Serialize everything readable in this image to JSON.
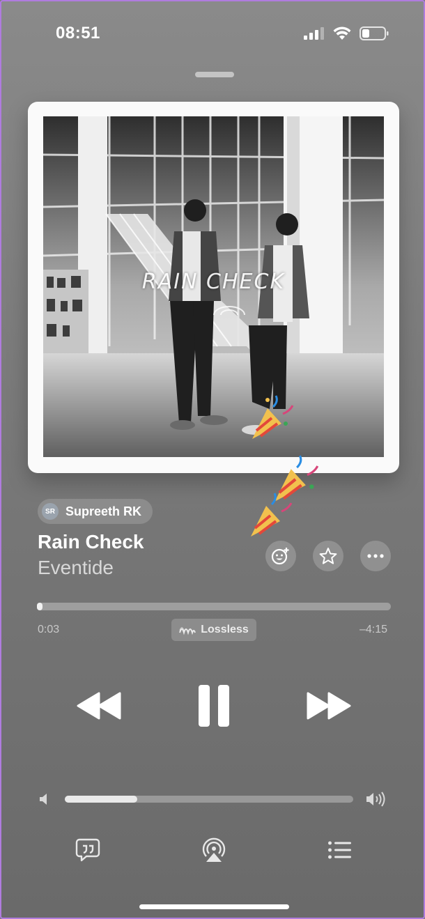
{
  "status_bar": {
    "time": "08:51"
  },
  "artwork": {
    "title_text": "RAIN CHECK"
  },
  "shared_by": {
    "initials": "SR",
    "name": "Supreeth RK"
  },
  "track": {
    "title": "Rain Check",
    "artist": "Eventide"
  },
  "playback": {
    "elapsed": "0:03",
    "remaining": "–4:15",
    "progress_fraction": 0.01,
    "quality_label": "Lossless"
  },
  "volume": {
    "level_fraction": 0.25
  },
  "icons": {
    "signal": "cellular-signal-icon",
    "wifi": "wifi-icon",
    "battery": "battery-icon",
    "react": "add-reaction-icon",
    "favorite": "star-icon",
    "more": "ellipsis-icon",
    "lossless": "lossless-wave-icon",
    "rewind": "rewind-icon",
    "pause": "pause-icon",
    "forward": "fast-forward-icon",
    "volume_low": "speaker-low-icon",
    "volume_high": "speaker-high-icon",
    "lyrics": "lyrics-bubble-icon",
    "airplay": "airplay-icon",
    "queue": "queue-list-icon"
  }
}
